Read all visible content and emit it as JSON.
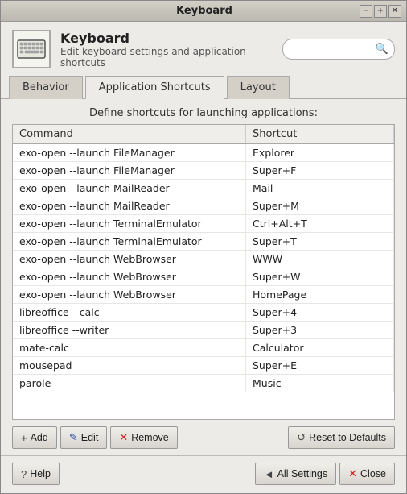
{
  "window": {
    "title": "Keyboard",
    "controls": {
      "minimize": "−",
      "maximize": "+",
      "close": "✕"
    }
  },
  "header": {
    "title": "Keyboard",
    "subtitle": "Edit keyboard settings and application shortcuts",
    "search_placeholder": ""
  },
  "tabs": [
    {
      "id": "behavior",
      "label": "Behavior",
      "active": false
    },
    {
      "id": "application-shortcuts",
      "label": "Application Shortcuts",
      "active": true
    },
    {
      "id": "layout",
      "label": "Layout",
      "active": false
    }
  ],
  "description": "Define shortcuts for launching applications:",
  "table": {
    "columns": [
      {
        "id": "command",
        "label": "Command"
      },
      {
        "id": "shortcut",
        "label": "Shortcut"
      }
    ],
    "rows": [
      {
        "command": "exo-open --launch FileManager",
        "shortcut": "Explorer"
      },
      {
        "command": "exo-open --launch FileManager",
        "shortcut": "Super+F"
      },
      {
        "command": "exo-open --launch MailReader",
        "shortcut": "Mail"
      },
      {
        "command": "exo-open --launch MailReader",
        "shortcut": "Super+M"
      },
      {
        "command": "exo-open --launch TerminalEmulator",
        "shortcut": "Ctrl+Alt+T"
      },
      {
        "command": "exo-open --launch TerminalEmulator",
        "shortcut": "Super+T"
      },
      {
        "command": "exo-open --launch WebBrowser",
        "shortcut": "WWW"
      },
      {
        "command": "exo-open --launch WebBrowser",
        "shortcut": "Super+W"
      },
      {
        "command": "exo-open --launch WebBrowser",
        "shortcut": "HomePage"
      },
      {
        "command": "libreoffice --calc",
        "shortcut": "Super+4"
      },
      {
        "command": "libreoffice --writer",
        "shortcut": "Super+3"
      },
      {
        "command": "mate-calc",
        "shortcut": "Calculator"
      },
      {
        "command": "mousepad",
        "shortcut": "Super+E"
      },
      {
        "command": "parole",
        "shortcut": "Music"
      }
    ]
  },
  "buttons": {
    "add": "Add",
    "edit": "Edit",
    "remove": "Remove",
    "reset_defaults": "Reset to Defaults",
    "help": "Help",
    "all_settings": "All Settings",
    "close": "Close"
  },
  "icons": {
    "add": "+",
    "edit": "✎",
    "remove": "✕",
    "reset": "↺",
    "help": "?",
    "arrow_left": "◄",
    "close_x": "✕",
    "search": "🔍"
  }
}
